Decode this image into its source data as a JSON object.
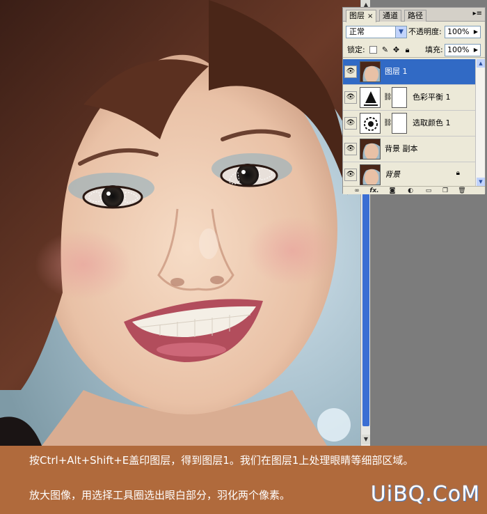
{
  "panel": {
    "tabs": [
      "图层",
      "通道",
      "路径"
    ],
    "close_glyph": "×",
    "menu_glyph": "▸≡",
    "blend_mode": "正常",
    "opacity_label": "不透明度:",
    "opacity_value": "100%",
    "lock_label": "锁定:",
    "fill_label": "填充:",
    "fill_value": "100%",
    "lock_icons": [
      "lock-transparent-icon",
      "lock-brush-icon",
      "lock-move-icon",
      "lock-all-icon"
    ]
  },
  "layers": [
    {
      "name": "图层 1",
      "selected": true,
      "type": "photo"
    },
    {
      "name": "色彩平衡 1",
      "selected": false,
      "type": "adjust-balance"
    },
    {
      "name": "选取颜色 1",
      "selected": false,
      "type": "adjust-selective"
    },
    {
      "name": "背景 副本",
      "selected": false,
      "type": "photo"
    },
    {
      "name": "背景",
      "selected": false,
      "type": "photo",
      "locked": true
    }
  ],
  "footer_icons": [
    "link-icon",
    "fx-icon",
    "mask-icon",
    "adjustment-icon",
    "folder-icon",
    "new-layer-icon",
    "trash-icon"
  ],
  "footer_labels": {
    "fx": "fx."
  },
  "caption": {
    "line1": "按Ctrl+Alt+Shift+E盖印图层，得到图层1。我们在图层1上处理眼睛等细部区域。",
    "line2": "放大图像，用选择工具圈选出眼白部分，羽化两个像素。"
  },
  "watermark": "UiBQ.CoM",
  "colors": {
    "caption_bg": "#b06a3c",
    "selection": "#316ac5",
    "panel_bg": "#ece9d8"
  }
}
